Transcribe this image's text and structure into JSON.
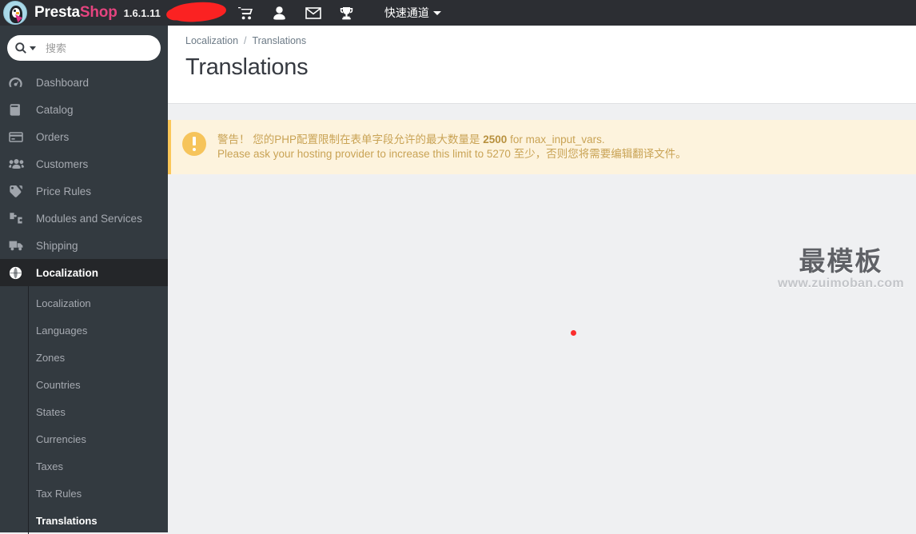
{
  "topbar": {
    "brand_presta": "Presta",
    "brand_shop": "Shop",
    "version": "1.6.1.11",
    "redacted_label": "",
    "icons": [
      {
        "name": "cart-icon",
        "title": "Shopping cart"
      },
      {
        "name": "user-icon",
        "title": "Customers"
      },
      {
        "name": "envelope-icon",
        "title": "Messages"
      },
      {
        "name": "trophy-icon",
        "title": "Achievements"
      }
    ],
    "quick_access_label": "快速通道",
    "bg_color": "#2c2e33",
    "brand_accent": "#e5447f"
  },
  "sidebar": {
    "search": {
      "placeholder": "搜索",
      "value": ""
    },
    "items": [
      {
        "label": "Dashboard",
        "icon": "dashboard-icon",
        "active": false
      },
      {
        "label": "Catalog",
        "icon": "catalog-icon",
        "active": false
      },
      {
        "label": "Orders",
        "icon": "orders-icon",
        "active": false
      },
      {
        "label": "Customers",
        "icon": "customers-icon",
        "active": false
      },
      {
        "label": "Price Rules",
        "icon": "tag-icon",
        "active": false
      },
      {
        "label": "Modules and Services",
        "icon": "puzzle-icon",
        "active": false
      },
      {
        "label": "Shipping",
        "icon": "truck-icon",
        "active": false
      },
      {
        "label": "Localization",
        "icon": "globe-icon",
        "active": true
      }
    ],
    "submenu": [
      {
        "label": "Localization",
        "active": false
      },
      {
        "label": "Languages",
        "active": false
      },
      {
        "label": "Zones",
        "active": false
      },
      {
        "label": "Countries",
        "active": false
      },
      {
        "label": "States",
        "active": false
      },
      {
        "label": "Currencies",
        "active": false
      },
      {
        "label": "Taxes",
        "active": false
      },
      {
        "label": "Tax Rules",
        "active": false
      },
      {
        "label": "Translations",
        "active": true
      }
    ],
    "bg_color": "#333a40",
    "active_bg_color": "#242629"
  },
  "page": {
    "breadcrumb": {
      "parent": "Localization",
      "separator": "/",
      "current": "Translations"
    },
    "title": "Translations"
  },
  "alert": {
    "icon": "warning-circle-icon",
    "line1_prefix": "警告！ 您的PHP配置限制在表单字段允许的最大数量是 ",
    "line1_value": "2500",
    "line1_suffix": " for max_input_vars.",
    "line2": "Please ask your hosting provider to increase this limit to 5270 至少，否则您将需要编辑翻译文件。",
    "bg_color": "#fdf3dd",
    "border_color": "#fbc758",
    "text_color": "#c9a355"
  },
  "watermark": {
    "text_cn": "最模板",
    "text_url": "www.zuimoban.com"
  },
  "marker": {
    "name": "red-dot-marker",
    "color": "#fb2e2e"
  }
}
